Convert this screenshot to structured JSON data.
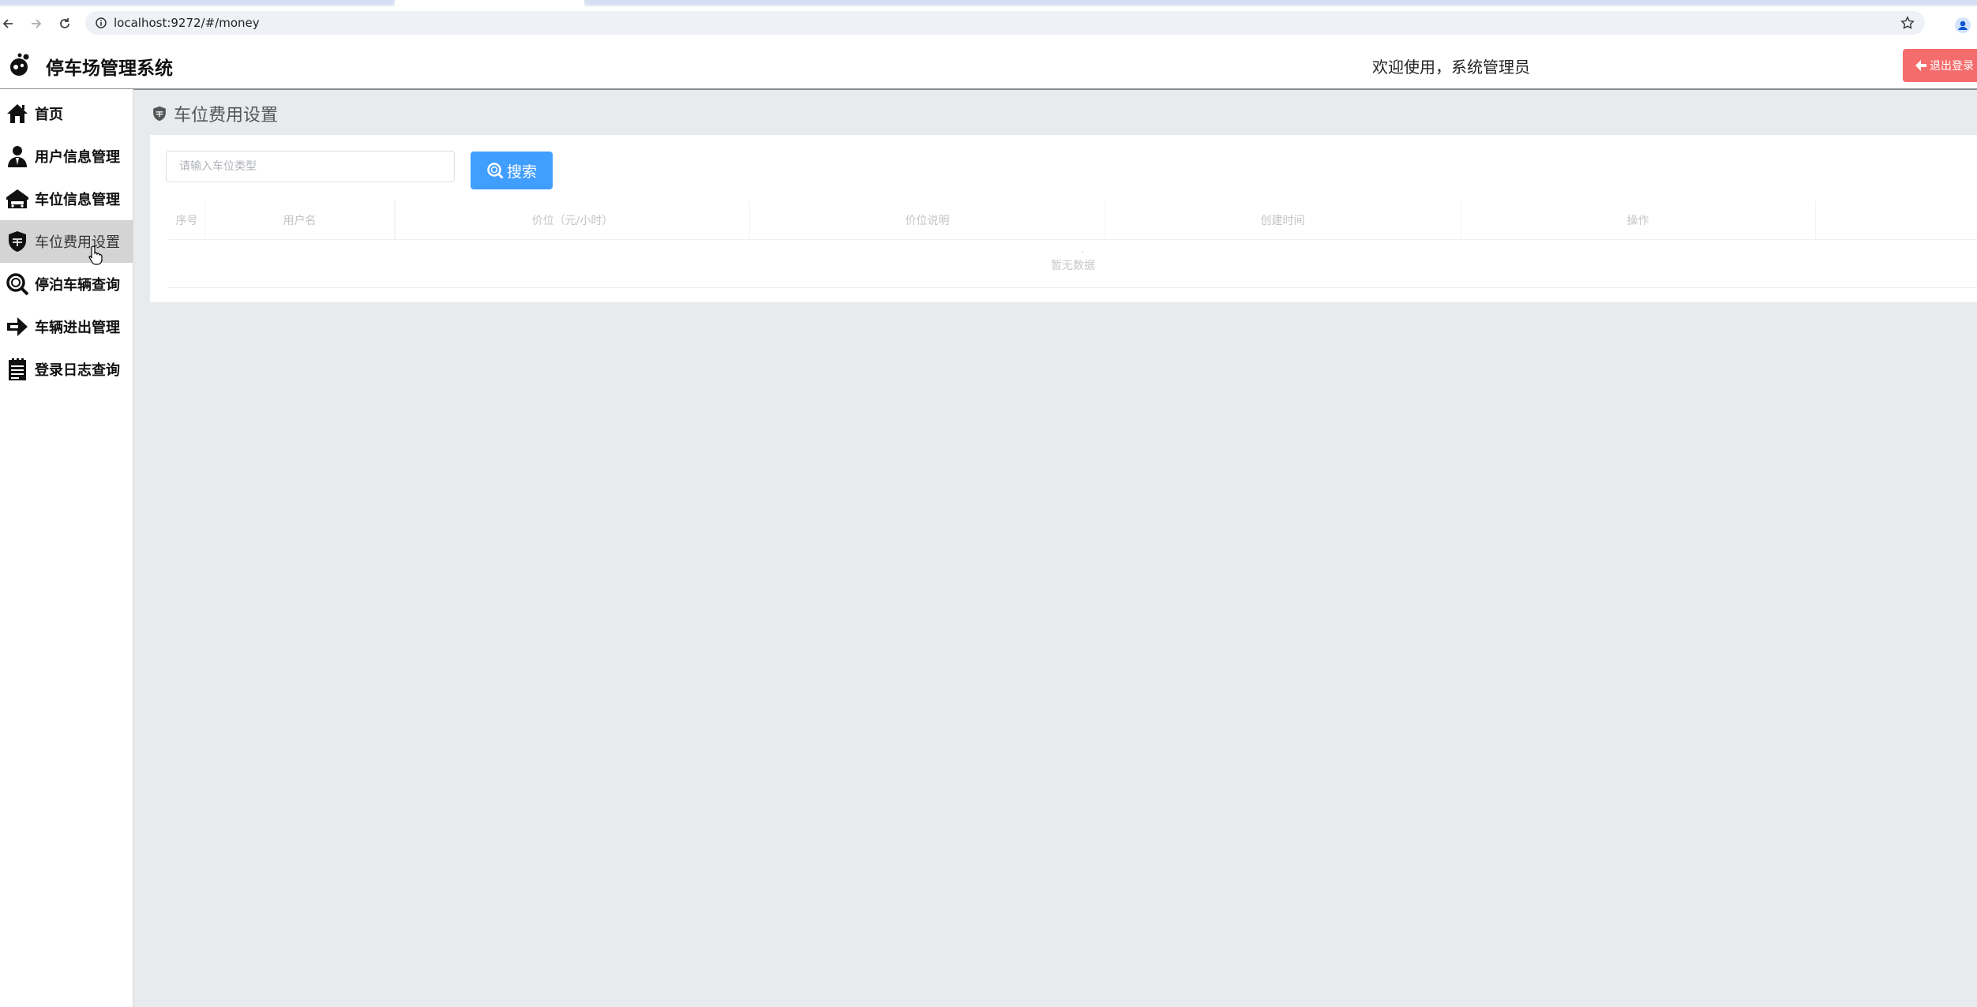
{
  "browser": {
    "url": "localhost:9272/#/money"
  },
  "header": {
    "title": "停车场管理系统",
    "welcome": "欢迎使用，系统管理员",
    "logout_label": "退出登录"
  },
  "sidebar": {
    "items": [
      {
        "label": "首页",
        "icon": "home-icon",
        "active": false
      },
      {
        "label": "用户信息管理",
        "icon": "user-icon",
        "active": false
      },
      {
        "label": "车位信息管理",
        "icon": "garage-icon",
        "active": false
      },
      {
        "label": "车位费用设置",
        "icon": "fee-icon",
        "active": true
      },
      {
        "label": "停泊车辆查询",
        "icon": "search-car-icon",
        "active": false
      },
      {
        "label": "车辆进出管理",
        "icon": "entry-exit-icon",
        "active": false
      },
      {
        "label": "登录日志查询",
        "icon": "log-icon",
        "active": false
      }
    ]
  },
  "page": {
    "title": "车位费用设置",
    "search_placeholder": "请输入车位类型",
    "search_button": "搜索",
    "table": {
      "columns": [
        "序号",
        "用户名",
        "价位（元/小时）",
        "价位说明",
        "创建时间",
        "操作"
      ],
      "empty_text": "暂无数据"
    }
  },
  "colors": {
    "primary": "#409eff",
    "danger": "#f56c6c",
    "sidebar_active": "#d4d4d4",
    "background": "#e8ebee"
  }
}
